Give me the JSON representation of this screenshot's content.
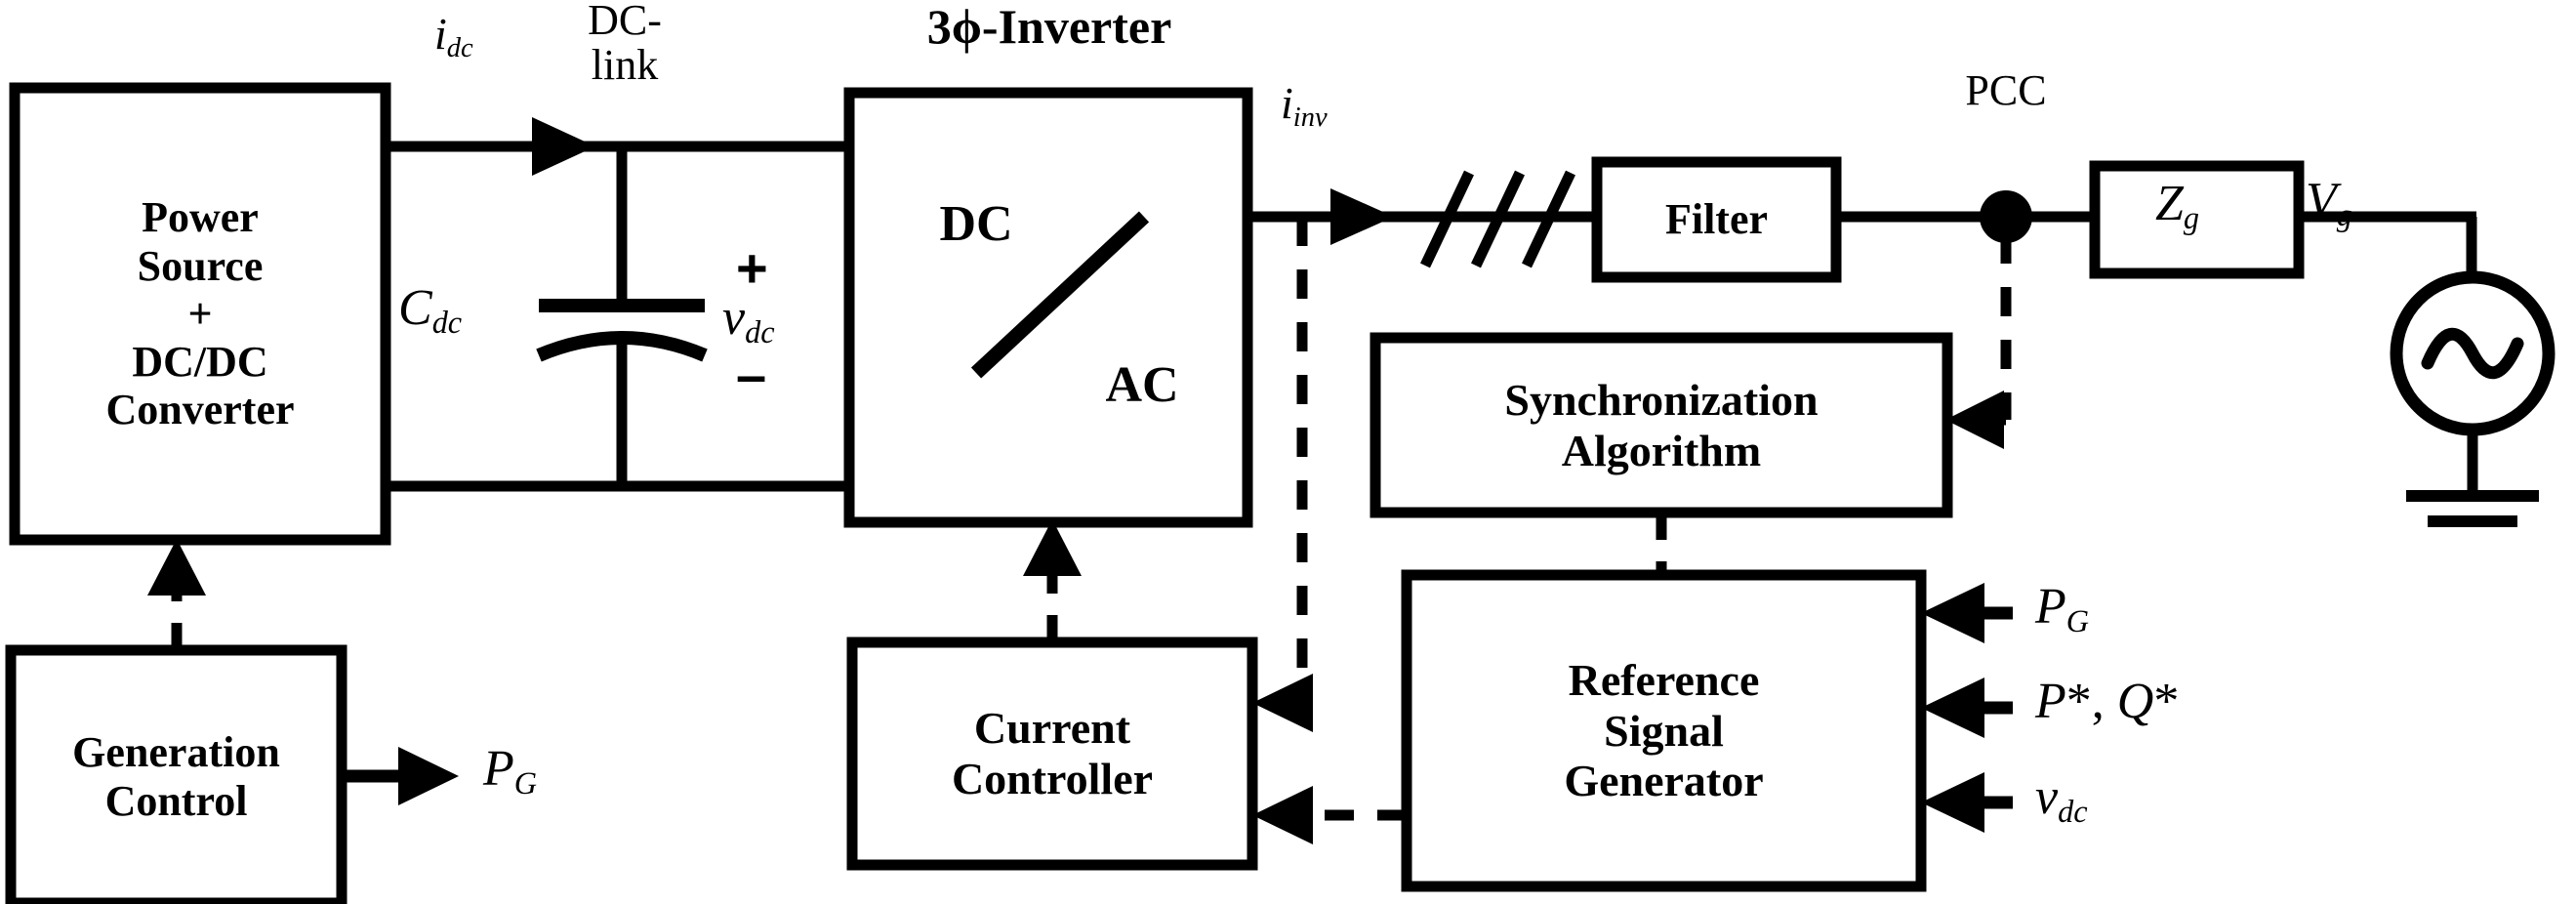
{
  "diagram": {
    "title": "3ϕ-Inverter",
    "blocks": [
      {
        "id": "power-source",
        "label": "Power\nSource\n+\nDC/DC\nConverter"
      },
      {
        "id": "inverter",
        "label_dc": "DC",
        "label_ac": "AC"
      },
      {
        "id": "filter",
        "label": "Filter"
      },
      {
        "id": "grid-impedance",
        "label": "Zg"
      },
      {
        "id": "synchronization-algorithm",
        "label": "Synchronization\nAlgorithm"
      },
      {
        "id": "reference-signal-generator",
        "label": "Reference\nSignal\nGenerator"
      },
      {
        "id": "current-controller",
        "label": "Current\nController"
      },
      {
        "id": "generation-control",
        "label": "Generation\nControl"
      }
    ],
    "signals": {
      "i_dc": "idc",
      "dc_link": "DC-\nlink",
      "c_dc": "Cdc",
      "v_dc": "vdc",
      "plus": "+",
      "minus": "–",
      "i_inv": "iinv",
      "pcc": "PCC",
      "v_g": "Vg",
      "z_g": "Zg",
      "p_g_out": "PG",
      "input_p_g": "PG",
      "input_pq_ref": "P*, Q*",
      "input_v_dc": "vdc"
    },
    "icons": {
      "ac_source": "ac-source-icon",
      "ground": "ground-icon",
      "capacitor": "capacitor-icon",
      "three_phase": "three-phase-slash-icon",
      "node": "junction-dot-icon"
    },
    "colors": {
      "stroke": "#000000",
      "background": "#ffffff"
    }
  }
}
